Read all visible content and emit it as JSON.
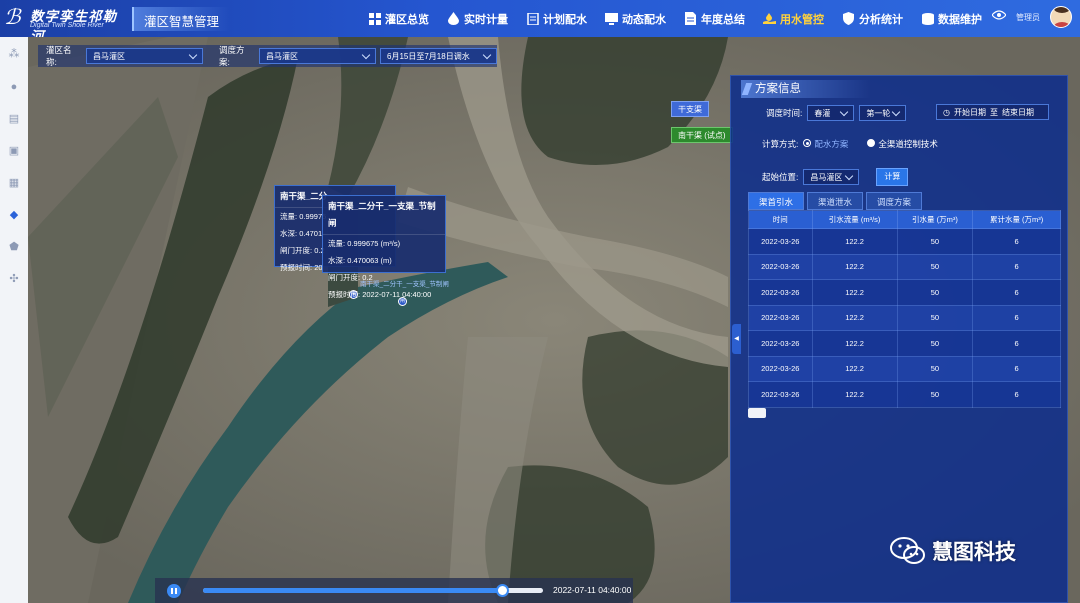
{
  "app": {
    "logo_cn": "数字孪生祁勒河",
    "logo_en": "Digital Twin Shole River",
    "system_title": "灌区智慧管理"
  },
  "nav": [
    {
      "label": "灌区总览",
      "icon": "dashboard-icon"
    },
    {
      "label": "实时计量",
      "icon": "drop-icon"
    },
    {
      "label": "计划配水",
      "icon": "list-icon"
    },
    {
      "label": "动态配水",
      "icon": "monitor-icon"
    },
    {
      "label": "年度总结",
      "icon": "document-icon"
    },
    {
      "label": "用水管控",
      "icon": "hand-water-icon",
      "active": true
    },
    {
      "label": "分析统计",
      "icon": "shield-icon"
    },
    {
      "label": "数据维护",
      "icon": "database-icon"
    }
  ],
  "user": {
    "name": "管理员"
  },
  "filters": {
    "area_label": "灌区名称:",
    "area_value": "昌马灌区",
    "plan_label": "调度方案:",
    "plan_value": "昌马灌区",
    "period_value": "6月15日至7月18日调水"
  },
  "map": {
    "tag_main": "干支渠",
    "tag_trial": "南干渠 (试点)",
    "canal_label": "南干渠_二分干_一支渠_节制闸",
    "popup_back": {
      "title": "南干渠_二分",
      "flow_label": "流量:",
      "flow_value": "0.99975",
      "depth_label": "水深:",
      "depth_value": "0.4701",
      "gate_label": "闸门开度:",
      "gate_value": "0.2",
      "time_label": "预报时间:",
      "time_value": "20"
    },
    "popup_front": {
      "title": "南干渠_二分干_一支渠_节制闸",
      "flow_label": "流量:",
      "flow_value": "0.999675 (m³/s)",
      "depth_label": "水深:",
      "depth_value": "0.470063 (m)",
      "gate_label": "闸门开度:",
      "gate_value": "0.2",
      "time_label": "预报时间:",
      "time_value": "2022-07-11 04:40:00"
    }
  },
  "panel": {
    "title": "方案信息",
    "schedule_label": "调度时间:",
    "season_value": "春灌",
    "round_value": "第一轮",
    "date_start": "开始日期",
    "date_sep": "至",
    "date_end": "结束日期",
    "calc_label": "计算方式:",
    "option1": "配水方案",
    "option2": "全渠道控制技术",
    "start_label": "起始位置:",
    "start_value": "昌马灌区",
    "calc_button": "计算",
    "tabs": [
      "渠首引水",
      "渠道泄水",
      "调度方案"
    ],
    "table": {
      "headers": [
        "时间",
        "引水流量 (m³/s)",
        "引水量 (万m³)",
        "累计水量 (万m³)"
      ],
      "rows": [
        [
          "2022-03-26",
          "122.2",
          "50",
          "6"
        ],
        [
          "2022-03-26",
          "122.2",
          "50",
          "6"
        ],
        [
          "2022-03-26",
          "122.2",
          "50",
          "6"
        ],
        [
          "2022-03-26",
          "122.2",
          "50",
          "6"
        ],
        [
          "2022-03-26",
          "122.2",
          "50",
          "6"
        ],
        [
          "2022-03-26",
          "122.2",
          "50",
          "6"
        ],
        [
          "2022-03-26",
          "122.2",
          "50",
          "6"
        ]
      ]
    }
  },
  "timeline": {
    "time": "2022-07-11 04:40:00",
    "progress": 0.88
  },
  "watermark": "慧图科技",
  "colors": {
    "accent": "#2e6fe6",
    "active_nav": "#ffd23c",
    "water": "#2f5a5a"
  }
}
